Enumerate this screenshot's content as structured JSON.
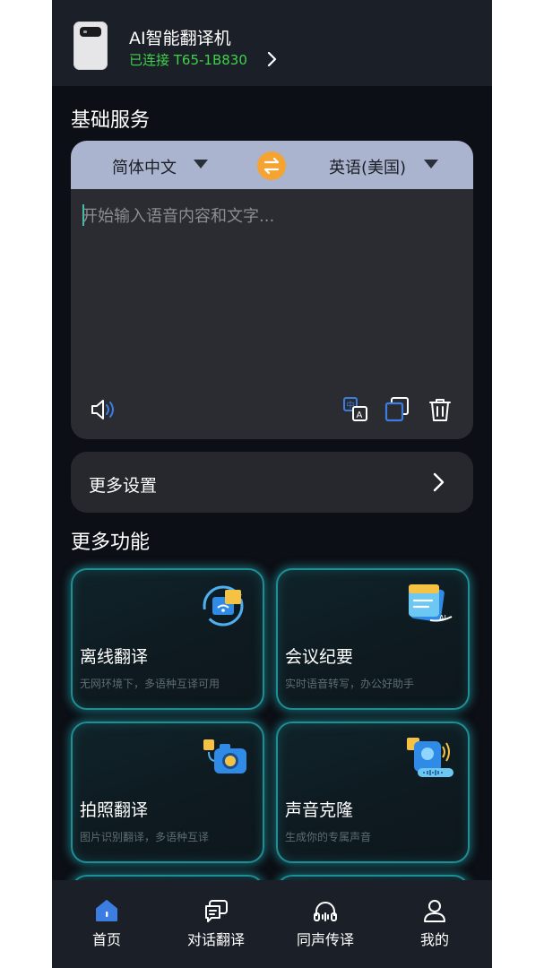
{
  "header": {
    "device_name": "AI智能翻译机",
    "connection_status": "已连接  T65-1B830"
  },
  "basic": {
    "section_title": "基础服务",
    "source_lang": "简体中文",
    "target_lang": "英语(美国)",
    "input_placeholder": "开始输入语音内容和文字..."
  },
  "settings": {
    "label": "更多设置"
  },
  "more": {
    "section_title": "更多功能",
    "features": [
      {
        "title": "离线翻译",
        "desc": "无网环境下，多语种互译可用"
      },
      {
        "title": "会议纪要",
        "desc": "实时语音转写，办公好助手"
      },
      {
        "title": "拍照翻译",
        "desc": "图片识别翻译，多语种互译"
      },
      {
        "title": "声音克隆",
        "desc": "生成你的专属声音"
      }
    ]
  },
  "nav": {
    "items": [
      {
        "label": "首页"
      },
      {
        "label": "对话翻译"
      },
      {
        "label": "同声传译"
      },
      {
        "label": "我的"
      }
    ]
  },
  "colors": {
    "connected_green": "#3fd24a",
    "accent_blue": "#3b7de0",
    "swap_orange": "#f5a431",
    "card_glow": "#1f8f96"
  }
}
